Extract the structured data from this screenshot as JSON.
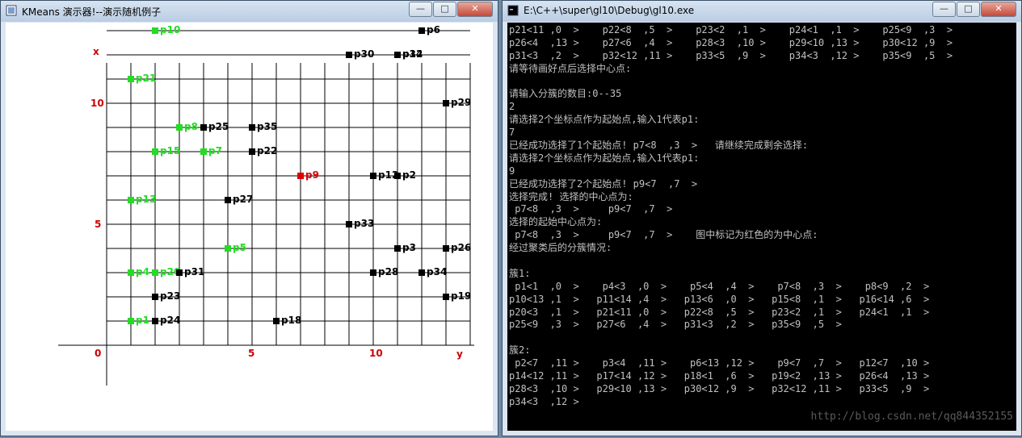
{
  "left_window": {
    "title": "KMeans 演示器!--演示随机例子",
    "buttons": {
      "minimize": "—",
      "maximize": "□",
      "close": "✕"
    }
  },
  "right_window": {
    "title": "E:\\C++\\super\\gl10\\Debug\\gl10.exe",
    "buttons": {
      "minimize": "—",
      "maximize": "□",
      "close": "✕"
    },
    "console_lines": [
      "p21<11 ,0  >    p22<8  ,5  >    p23<2  ,1  >    p24<1  ,1  >    p25<9  ,3  >",
      "p26<4  ,13 >    p27<6  ,4  >    p28<3  ,10 >    p29<10 ,13 >    p30<12 ,9  >",
      "p31<3  ,2  >    p32<12 ,11 >    p33<5  ,9  >    p34<3  ,12 >    p35<9  ,5  >",
      "请等待画好点后选择中心点:",
      "",
      "请输入分簇的数目:0--35",
      "2",
      "请选择2个坐标点作为起始点,输入1代表p1:",
      "7",
      "已经成功选择了1个起始点! p7<8  ,3  >   请继续完成剩余选择:",
      "请选择2个坐标点作为起始点,输入1代表p1:",
      "9",
      "已经成功选择了2个起始点! p9<7  ,7  >",
      "选择完成! 选择的中心点为:",
      " p7<8  ,3  >     p9<7  ,7  >",
      "选择的起始中心点为:",
      " p7<8  ,3  >     p9<7  ,7  >    图中标记为红色的为中心点:",
      "经过聚类后的分簇情况:",
      "",
      "簇1:",
      " p1<1  ,0  >    p4<3  ,0  >    p5<4  ,4  >    p7<8  ,3  >    p8<9  ,2  >",
      "p10<13 ,1  >   p11<14 ,4  >   p13<6  ,0  >   p15<8  ,1  >   p16<14 ,6  >",
      "p20<3  ,1  >   p21<11 ,0  >   p22<8  ,5  >   p23<2  ,1  >   p24<1  ,1  >",
      "p25<9  ,3  >   p27<6  ,4  >   p31<3  ,2  >   p35<9  ,5  >",
      "",
      "簇2:",
      " p2<7  ,11 >    p3<4  ,11 >    p6<13 ,12 >    p9<7  ,7  >   p12<7  ,10 >",
      "p14<12 ,11 >   p17<14 ,12 >   p18<1  ,6  >   p19<2  ,13 >   p26<4  ,13 >",
      "p28<3  ,10 >   p29<10 ,13 >   p30<12 ,9  >   p32<12 ,11 >   p33<5  ,9  >",
      "p34<3  ,12 >"
    ],
    "watermark": "http://blog.csdn.net/qq844352155"
  },
  "chart_data": {
    "type": "scatter",
    "axis_labels": {
      "vertical": "x",
      "horizontal": "y"
    },
    "ticks": {
      "vertical": [
        "0",
        "5",
        "10"
      ],
      "horizontal": [
        "5",
        "10"
      ]
    },
    "grid": true,
    "colors": {
      "cluster1": "#22dd22",
      "cluster2": "#000000",
      "center": "#dd0000",
      "axis_text": "#cc0000"
    },
    "points": [
      {
        "name": "p1",
        "x": 1,
        "y": 0,
        "group": "cluster1"
      },
      {
        "name": "p2",
        "x": 7,
        "y": 11,
        "group": "cluster2"
      },
      {
        "name": "p3",
        "x": 4,
        "y": 11,
        "group": "cluster2"
      },
      {
        "name": "p4",
        "x": 3,
        "y": 0,
        "group": "cluster1"
      },
      {
        "name": "p5",
        "x": 4,
        "y": 4,
        "group": "cluster1"
      },
      {
        "name": "p6",
        "x": 13,
        "y": 12,
        "group": "cluster2"
      },
      {
        "name": "p7",
        "x": 8,
        "y": 3,
        "group": "cluster1"
      },
      {
        "name": "p8",
        "x": 9,
        "y": 2,
        "group": "cluster1"
      },
      {
        "name": "p9",
        "x": 7,
        "y": 7,
        "group": "center"
      },
      {
        "name": "p10",
        "x": 13,
        "y": 1,
        "group": "cluster1"
      },
      {
        "name": "p11",
        "x": 14,
        "y": 4,
        "group": "cluster1"
      },
      {
        "name": "p12",
        "x": 7,
        "y": 10,
        "group": "cluster2"
      },
      {
        "name": "p13",
        "x": 6,
        "y": 0,
        "group": "cluster1"
      },
      {
        "name": "p14",
        "x": 12,
        "y": 11,
        "group": "cluster2"
      },
      {
        "name": "p15",
        "x": 8,
        "y": 1,
        "group": "cluster1"
      },
      {
        "name": "p16",
        "x": 14,
        "y": 6,
        "group": "cluster1"
      },
      {
        "name": "p17",
        "x": 14,
        "y": 12,
        "group": "cluster2"
      },
      {
        "name": "p18",
        "x": 1,
        "y": 6,
        "group": "cluster2"
      },
      {
        "name": "p19",
        "x": 2,
        "y": 13,
        "group": "cluster2"
      },
      {
        "name": "p20",
        "x": 3,
        "y": 1,
        "group": "cluster1"
      },
      {
        "name": "p21",
        "x": 11,
        "y": 0,
        "group": "cluster1"
      },
      {
        "name": "p22",
        "x": 8,
        "y": 5,
        "group": "cluster2"
      },
      {
        "name": "p23",
        "x": 2,
        "y": 1,
        "group": "cluster2"
      },
      {
        "name": "p24",
        "x": 1,
        "y": 1,
        "group": "cluster2"
      },
      {
        "name": "p25",
        "x": 9,
        "y": 3,
        "group": "cluster2"
      },
      {
        "name": "p26",
        "x": 4,
        "y": 13,
        "group": "cluster2"
      },
      {
        "name": "p27",
        "x": 6,
        "y": 4,
        "group": "cluster2"
      },
      {
        "name": "p28",
        "x": 3,
        "y": 10,
        "group": "cluster2"
      },
      {
        "name": "p29",
        "x": 10,
        "y": 13,
        "group": "cluster2"
      },
      {
        "name": "p30",
        "x": 12,
        "y": 9,
        "group": "cluster2"
      },
      {
        "name": "p31",
        "x": 3,
        "y": 2,
        "group": "cluster2"
      },
      {
        "name": "p32",
        "x": 12,
        "y": 11,
        "group": "cluster2"
      },
      {
        "name": "p33",
        "x": 5,
        "y": 9,
        "group": "cluster2"
      },
      {
        "name": "p34",
        "x": 3,
        "y": 12,
        "group": "cluster2"
      },
      {
        "name": "p35",
        "x": 9,
        "y": 5,
        "group": "cluster2"
      }
    ]
  }
}
